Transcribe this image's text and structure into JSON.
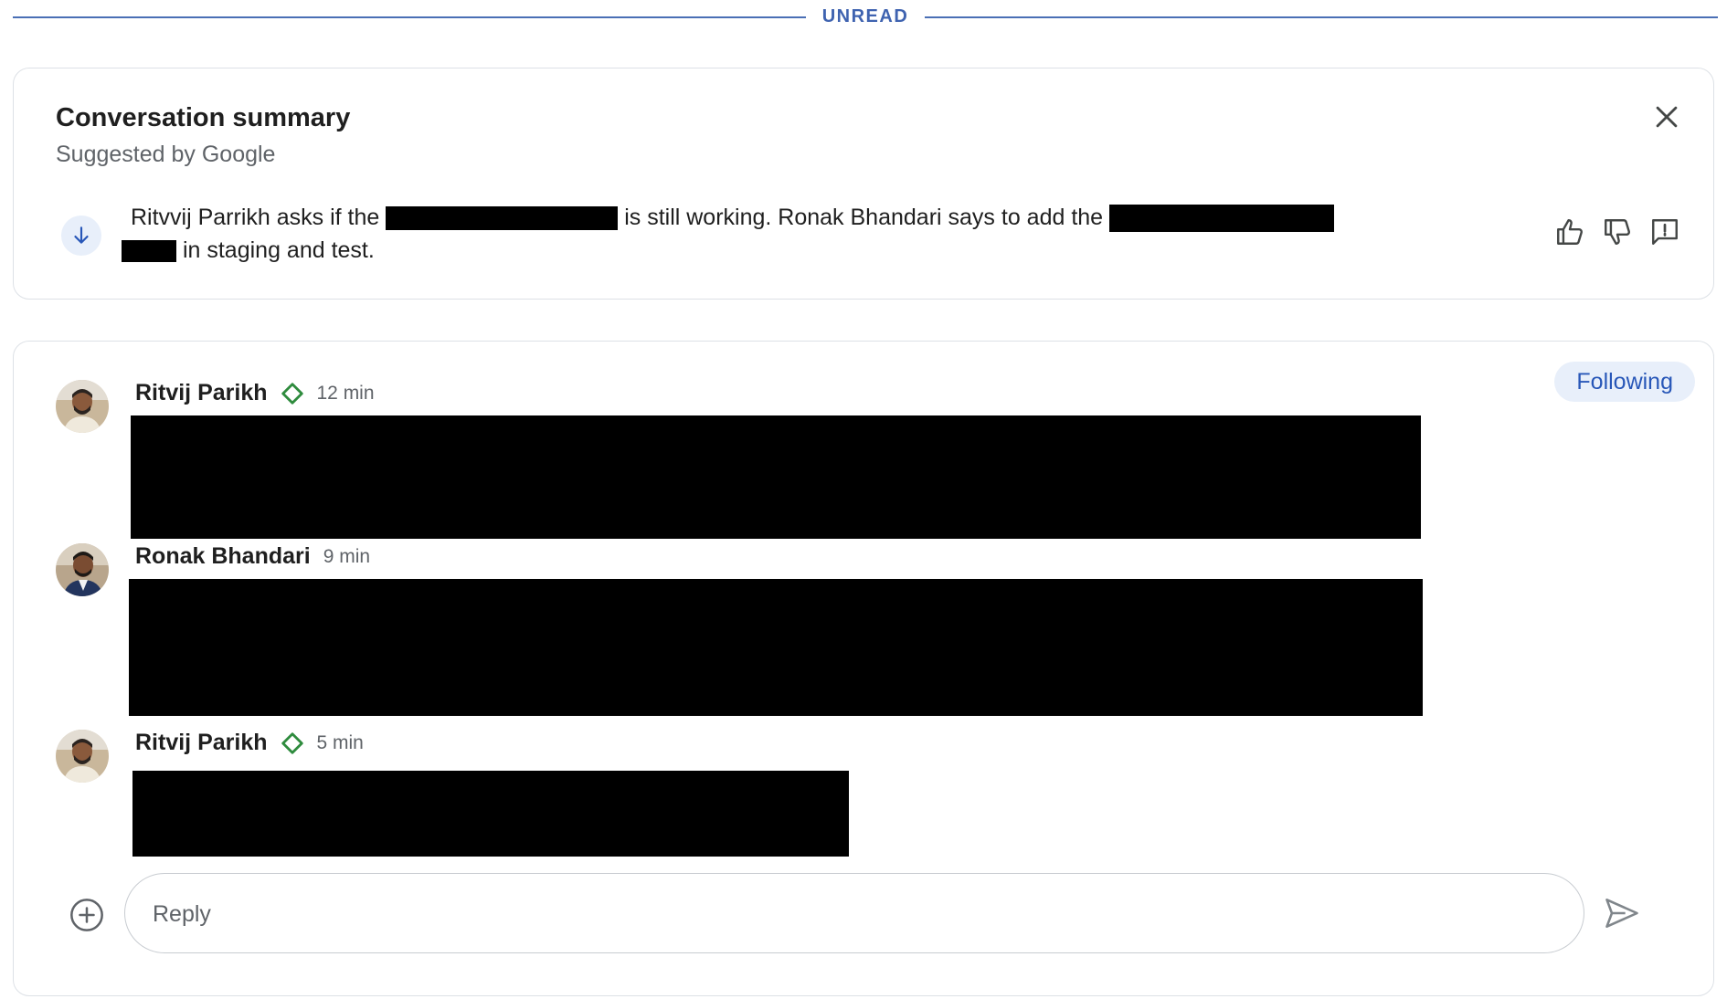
{
  "divider": {
    "label": "UNREAD"
  },
  "summary": {
    "title": "Conversation summary",
    "subtitle": "Suggested by Google",
    "text_parts": [
      "Ritvvij Parrikh asks if the",
      "is still working. Ronak Bhandari says to add the",
      "in staging and test."
    ],
    "icons": {
      "close": "close-icon",
      "expand": "arrow-down-icon",
      "thumbs_up": "thumbs-up-icon",
      "thumbs_down": "thumbs-down-icon",
      "feedback": "feedback-icon"
    }
  },
  "thread": {
    "following_label": "Following",
    "messages": [
      {
        "author": "Ritvij Parikh",
        "time": "12 min",
        "badge": "diamond-icon"
      },
      {
        "author": "Ronak Bhandari",
        "time": "9 min"
      },
      {
        "author": "Ritvij Parikh",
        "time": "5 min",
        "badge": "diamond-icon"
      }
    ],
    "reply": {
      "placeholder": "Reply"
    },
    "icons": {
      "add": "add-circle-icon",
      "send": "send-icon"
    }
  },
  "colors": {
    "accent": "#3f63b0",
    "chip_bg": "#e8effa",
    "badge_green": "#2e8b3d",
    "border": "#dde1e6"
  }
}
